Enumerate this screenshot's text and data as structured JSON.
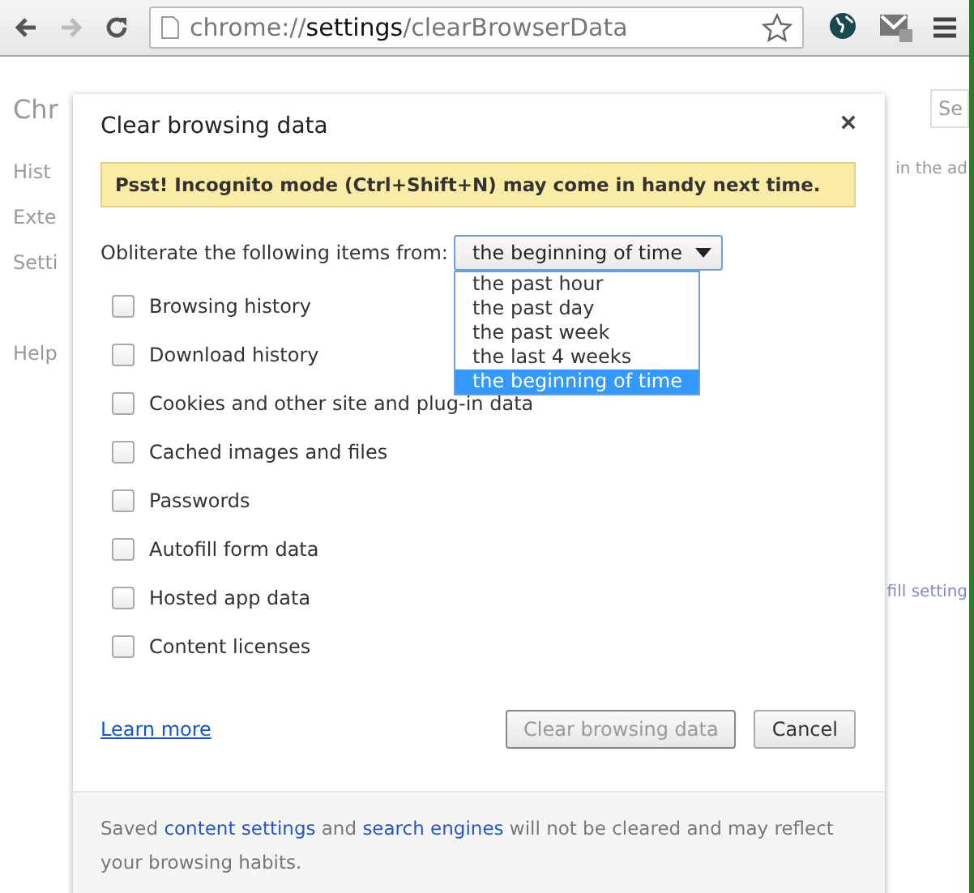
{
  "toolbar": {
    "address": {
      "scheme": "chrome://",
      "host": "settings",
      "path": "/clearBrowserData"
    }
  },
  "background": {
    "title": "Chr",
    "search_placeholder": "Se",
    "nav": [
      "Hist",
      "Exte",
      "Setti",
      "Help"
    ],
    "fragments": [
      "in the ad",
      "fill setting"
    ]
  },
  "dialog": {
    "title": "Clear browsing data",
    "notice": "Psst! Incognito mode (Ctrl+Shift+N) may come in handy next time.",
    "range_label": "Obliterate the following items from:",
    "range_value": "the beginning of time",
    "range_options": [
      {
        "label": "the past hour",
        "selected": false
      },
      {
        "label": "the past day",
        "selected": false
      },
      {
        "label": "the past week",
        "selected": false
      },
      {
        "label": "the last 4 weeks",
        "selected": false
      },
      {
        "label": "the beginning of time",
        "selected": true
      }
    ],
    "items": [
      {
        "label": "Browsing history",
        "checked": false
      },
      {
        "label": "Download history",
        "checked": false
      },
      {
        "label": "Cookies and other site and plug-in data",
        "checked": false
      },
      {
        "label": "Cached images and files",
        "checked": false
      },
      {
        "label": "Passwords",
        "checked": false
      },
      {
        "label": "Autofill form data",
        "checked": false
      },
      {
        "label": "Hosted app data",
        "checked": false
      },
      {
        "label": "Content licenses",
        "checked": false
      }
    ],
    "learn_more": "Learn more",
    "buttons": [
      {
        "label": "Clear browsing data",
        "disabled": true
      },
      {
        "label": "Cancel",
        "disabled": false
      }
    ],
    "footer": [
      {
        "kind": "text",
        "text": "Saved "
      },
      {
        "kind": "link",
        "text": "content settings"
      },
      {
        "kind": "text",
        "text": " and "
      },
      {
        "kind": "link",
        "text": "search engines"
      },
      {
        "kind": "text",
        "text": " will not be cleared and may reflect your browsing habits."
      }
    ]
  }
}
